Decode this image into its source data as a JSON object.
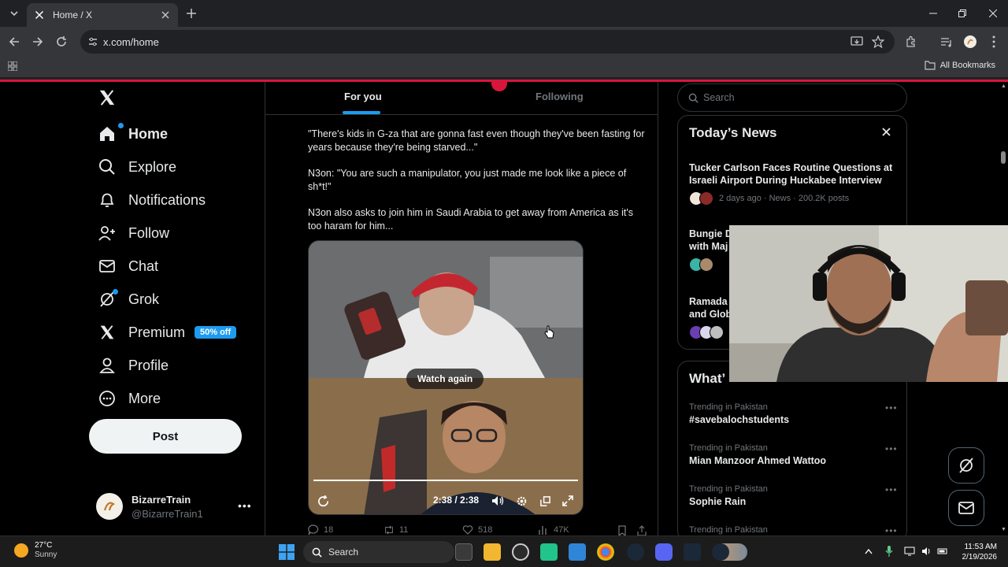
{
  "browser": {
    "tab_title": "Home / X",
    "url": "x.com/home",
    "bookmarks_label": "All Bookmarks"
  },
  "nav": {
    "items": [
      {
        "label": "Home",
        "icon": "home-icon"
      },
      {
        "label": "Explore",
        "icon": "search-icon"
      },
      {
        "label": "Notifications",
        "icon": "bell-icon"
      },
      {
        "label": "Follow",
        "icon": "add-person-icon"
      },
      {
        "label": "Chat",
        "icon": "envelope-icon"
      },
      {
        "label": "Grok",
        "icon": "grok-icon"
      },
      {
        "label": "Premium",
        "icon": "x-logo-icon"
      },
      {
        "label": "Profile",
        "icon": "person-icon"
      },
      {
        "label": "More",
        "icon": "more-circle-icon"
      }
    ],
    "premium_badge": "50% off",
    "post_label": "Post",
    "account": {
      "name": "BizarreTrain",
      "handle": "@BizarreTrain1"
    }
  },
  "feed": {
    "tabs": [
      "For you",
      "Following"
    ],
    "paragraphs": [
      "\"There's kids in G-za that are gonna fast even though they've been fasting for years because they're being starved...\"",
      "N3on: \"You are such a manipulator, you just made me look like a piece of sh*t!\"",
      "N3on also asks to join him in Saudi Arabia to get away from America as it's too haram for him..."
    ],
    "video": {
      "watch_again": "Watch again",
      "time": "2:38 / 2:38",
      "progress": 1.0
    },
    "actions": {
      "replies": "18",
      "reposts": "11",
      "likes": "518",
      "views": "47K"
    }
  },
  "right": {
    "search_placeholder": "Search",
    "news_title": "Today’s News",
    "news": [
      {
        "headline": "Tucker Carlson Faces Routine Questions at Israeli Airport During Huckabee Interview",
        "meta": "2 days ago · News · 200.2K posts"
      },
      {
        "headline": "Bungie D",
        "headline2": "with Maj",
        "meta": ""
      },
      {
        "headline": "Ramada",
        "headline2": "and Glob",
        "meta": ""
      }
    ],
    "happening_title": "What’s happening",
    "happening_visible": "What’",
    "trends": [
      {
        "context": "Trending in Pakistan",
        "name": "#savebalochstudents"
      },
      {
        "context": "Trending in Pakistan",
        "name": "Mian Manzoor Ahmed Wattoo"
      },
      {
        "context": "Trending in Pakistan",
        "name": "Sophie Rain"
      },
      {
        "context": "Trending in Pakistan",
        "name": ""
      }
    ]
  },
  "taskbar": {
    "weather_temp": "27°C",
    "weather_desc": "Sunny",
    "search_label": "Search",
    "time": "11:53 AM",
    "date": "2/19/2026"
  },
  "colors": {
    "accent": "#1d9bf0",
    "brand_red": "#d8163b"
  }
}
